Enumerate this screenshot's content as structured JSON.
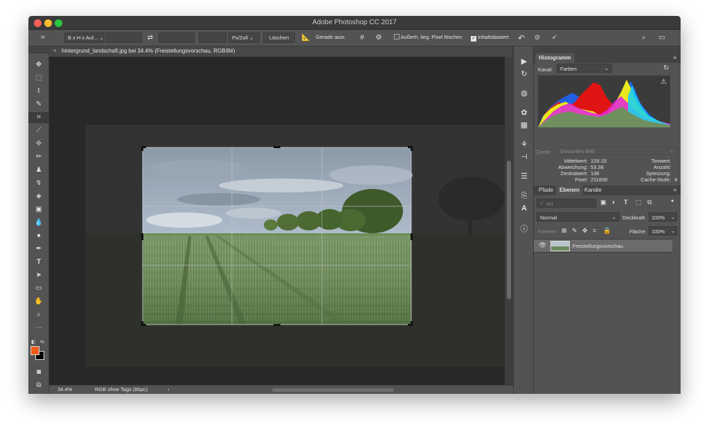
{
  "app": {
    "title": "Adobe Photoshop CC 2017"
  },
  "options": {
    "ratio": "B x H x Auf...",
    "unit": "Px/Zoll",
    "clear": "Löschen",
    "straighten": "Gerade ausr.",
    "delete_outside": "Außerh. lieg. Pixel löschen",
    "content_aware": "Inhaltsbasiert"
  },
  "document": {
    "tab_title": "hintergrund_landschaft.jpg bei 34.4% (Freistellungsvorschau, RGB/8#)",
    "zoom": "34.4%",
    "profile": "RGB ohne Tags (8bpc)"
  },
  "histogram": {
    "panel_title": "Histogramm",
    "channel_label": "Kanal:",
    "channel": "Farben",
    "source_label": "Quelle:",
    "source": "Gesamtes Bild",
    "stats": {
      "mean_label": "Mittelwert:",
      "mean": "128.15",
      "stddev_label": "Abweichung:",
      "stddev": "53.38",
      "median_label": "Zentralwert:",
      "median": "136",
      "pixels_label": "Pixel:",
      "pixels": "211830",
      "level_label": "Tonwert:",
      "count_label": "Anzahl:",
      "percentile_label": "Spreizung:",
      "cache_label": "Cache-Stufe:",
      "cache": "4"
    }
  },
  "layers": {
    "tabs": [
      "Pfade",
      "Ebenen",
      "Kanäle"
    ],
    "filter_placeholder": "Art",
    "blend_mode": "Normal",
    "opacity_label": "Deckkraft:",
    "opacity": "100%",
    "lock_label": "Fixieren:",
    "fill_label": "Fläche:",
    "fill": "100%",
    "items": [
      {
        "name": "Freistellungsvorschau"
      }
    ]
  },
  "colors": {
    "foreground": "#f05a1a",
    "background": "#000000"
  }
}
